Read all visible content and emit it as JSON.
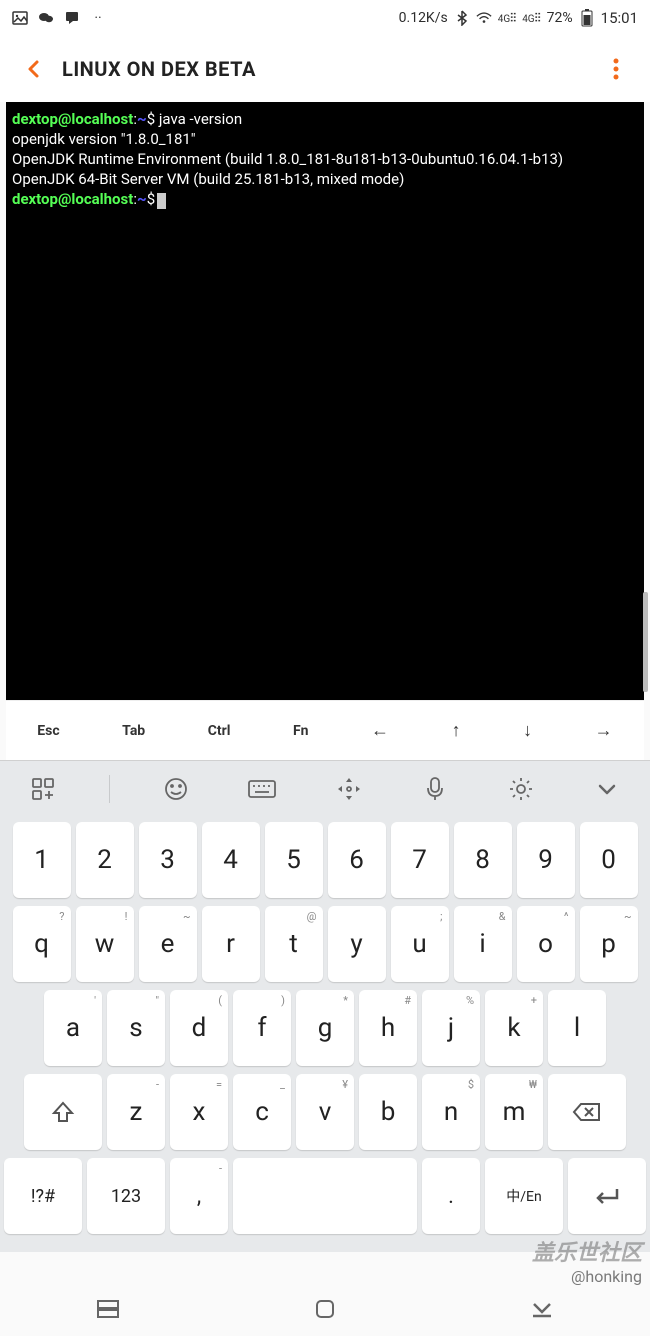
{
  "status": {
    "speed": "0.12K/s",
    "battery": "72%",
    "time": "15:01"
  },
  "header": {
    "title": "LINUX ON DEX BETA"
  },
  "terminal": {
    "prompt_user": "dextop@localhost",
    "prompt_path": "~",
    "prompt_symbol": "$",
    "cmd1": " java -version",
    "out1": "openjdk version \"1.8.0_181\"",
    "out2": "OpenJDK Runtime Environment (build 1.8.0_181-8u181-b13-0ubuntu0.16.04.1-b13)",
    "out3": "OpenJDK 64-Bit Server VM (build 25.181-b13, mixed mode)"
  },
  "acc_keys": [
    "Esc",
    "Tab",
    "Ctrl",
    "Fn",
    "←",
    "↑",
    "↓",
    "→"
  ],
  "keyboard": {
    "row_num": [
      "1",
      "2",
      "3",
      "4",
      "5",
      "6",
      "7",
      "8",
      "9",
      "0"
    ],
    "row1": [
      {
        "k": "q",
        "s": "?"
      },
      {
        "k": "w",
        "s": "!"
      },
      {
        "k": "e",
        "s": "~"
      },
      {
        "k": "r",
        "s": ""
      },
      {
        "k": "t",
        "s": "@"
      },
      {
        "k": "y",
        "s": ""
      },
      {
        "k": "u",
        "s": ";"
      },
      {
        "k": "i",
        "s": "&"
      },
      {
        "k": "o",
        "s": "^"
      },
      {
        "k": "p",
        "s": "~"
      }
    ],
    "row2": [
      {
        "k": "a",
        "s": "'"
      },
      {
        "k": "s",
        "s": "\""
      },
      {
        "k": "d",
        "s": "("
      },
      {
        "k": "f",
        "s": ")"
      },
      {
        "k": "g",
        "s": "*"
      },
      {
        "k": "h",
        "s": "#"
      },
      {
        "k": "j",
        "s": "%"
      },
      {
        "k": "k",
        "s": "+"
      },
      {
        "k": "l",
        "s": ""
      }
    ],
    "row3": [
      {
        "k": "z",
        "s": "-"
      },
      {
        "k": "x",
        "s": "="
      },
      {
        "k": "c",
        "s": "_"
      },
      {
        "k": "v",
        "s": "¥"
      },
      {
        "k": "b",
        "s": ""
      },
      {
        "k": "n",
        "s": "$"
      },
      {
        "k": "m",
        "s": "₩"
      }
    ],
    "fn": "!?#",
    "num_switch": "123",
    "comma": ",",
    "period": ".",
    "lang": "中/En"
  },
  "watermark": {
    "line1": "盖乐世社区",
    "line2": "@honking"
  }
}
